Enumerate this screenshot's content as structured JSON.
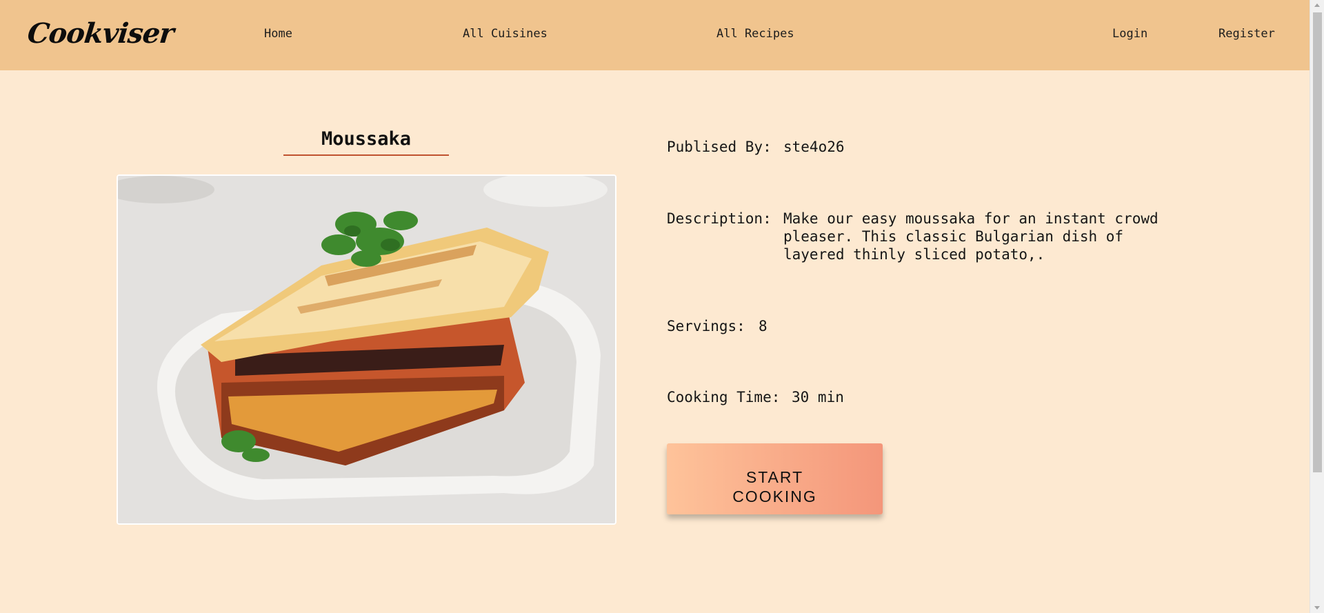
{
  "nav": {
    "logo": "Cookviser",
    "links": {
      "home": "Home",
      "cuisines": "All Cuisines",
      "recipes": "All Recipes",
      "login": "Login",
      "register": "Register"
    }
  },
  "recipe": {
    "title": "Moussaka",
    "published_label": "Publised By:",
    "published_value": "ste4o26",
    "description_label": "Description:",
    "description_value": "Make our easy moussaka for an instant crowd pleaser. This classic Bulgarian dish of layered thinly sliced potato,.",
    "servings_label": "Servings:",
    "servings_value": "8",
    "cooking_label": "Cooking Time:",
    "cooking_value": "30 min",
    "start_button": "START COOKING"
  },
  "colors": {
    "navbar": "#f0c48e",
    "background": "#fde9d1",
    "accent_underline": "#c0522f",
    "button_start": "#fec39a",
    "button_end": "#f4967a"
  }
}
